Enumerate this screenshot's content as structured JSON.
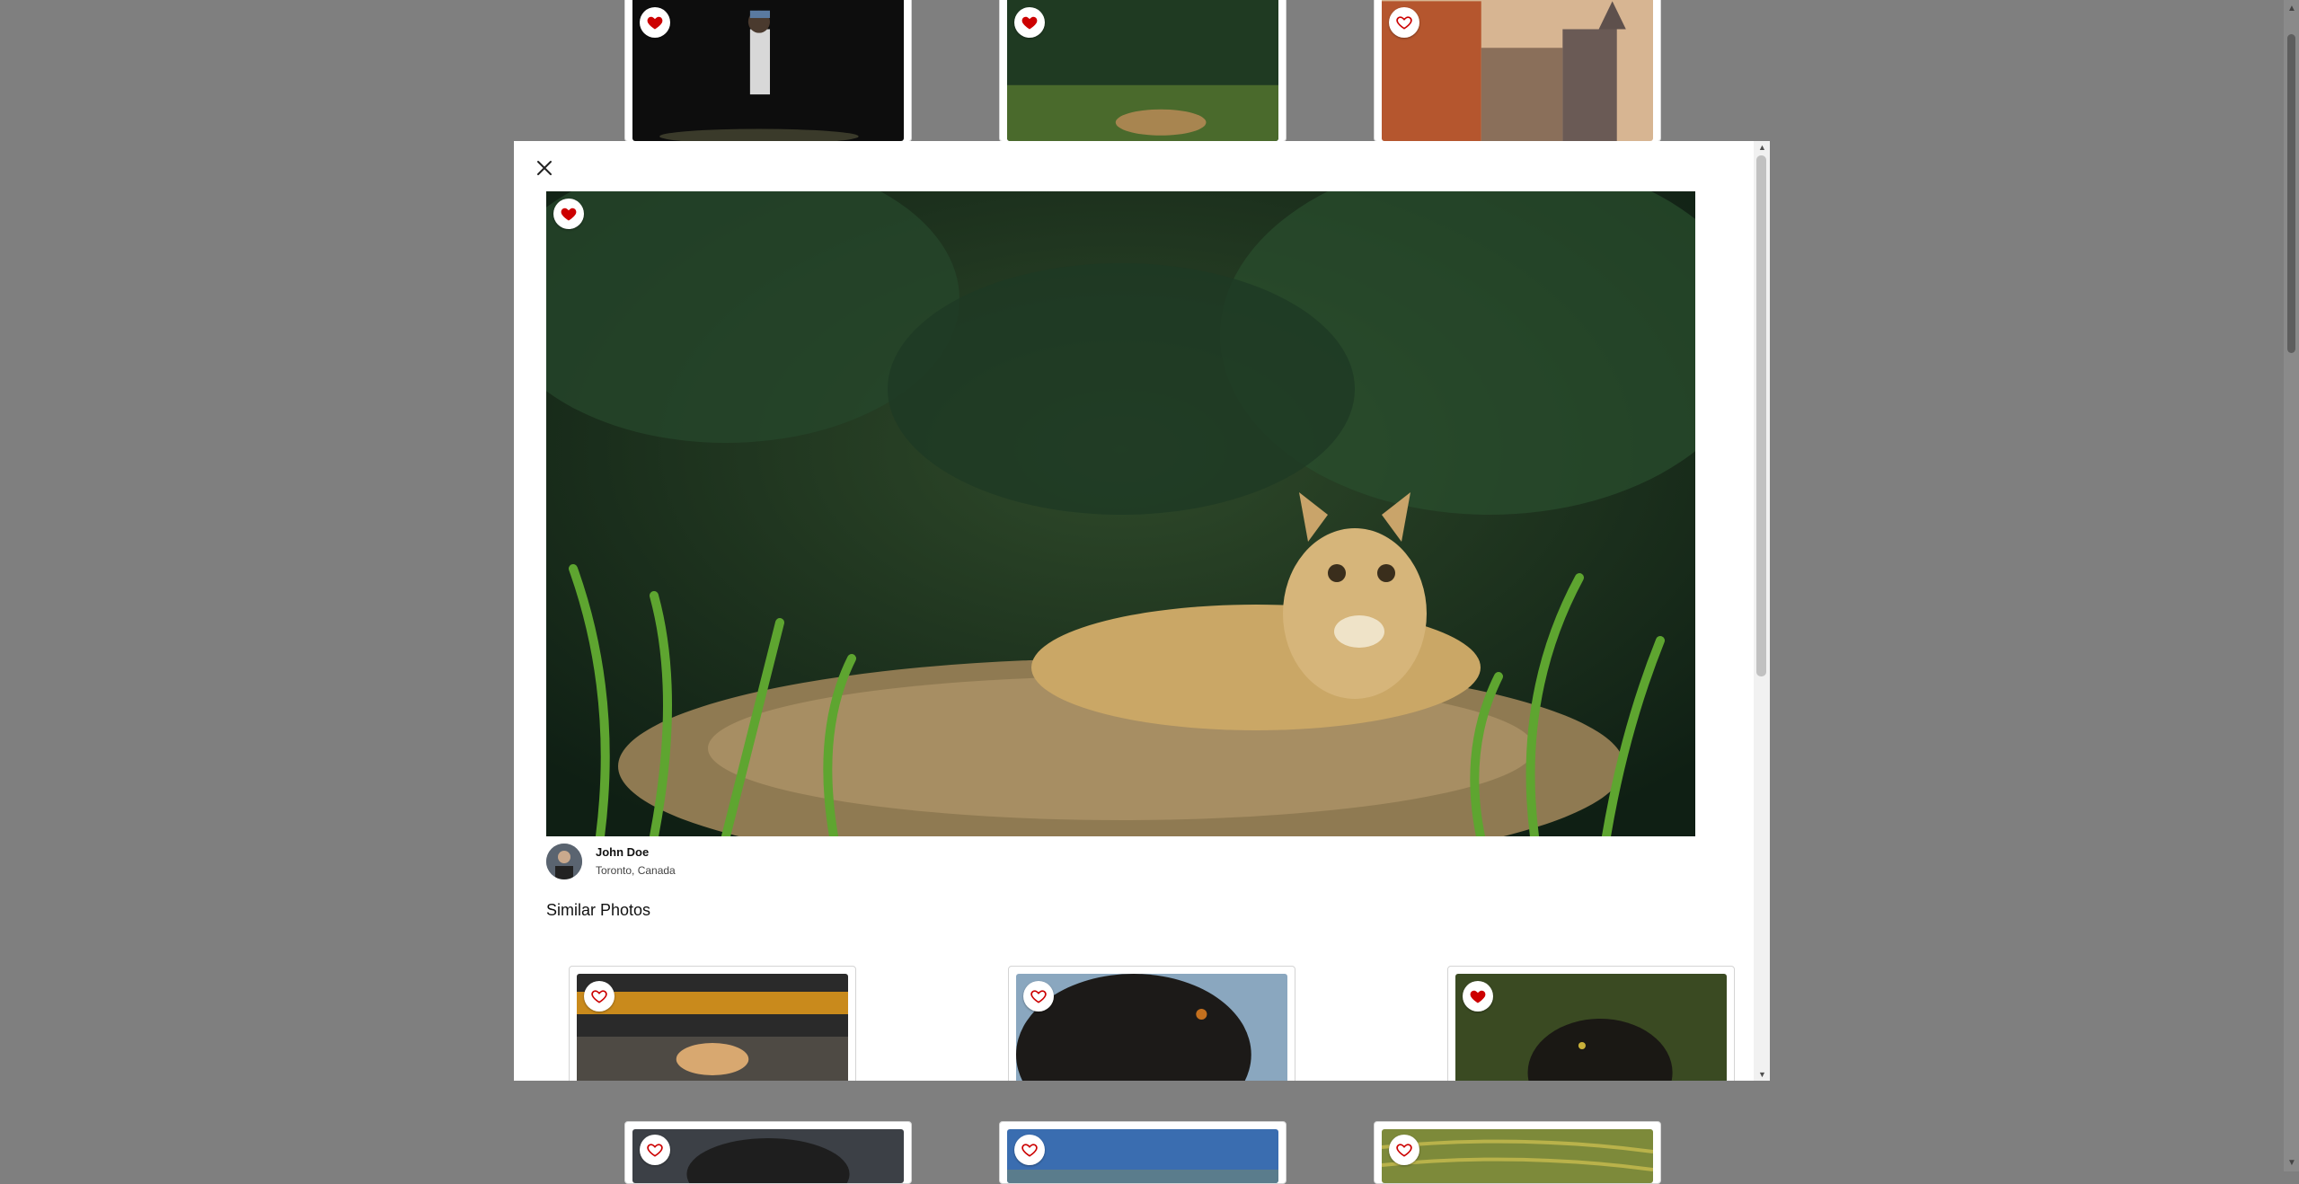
{
  "colors": {
    "accent_heart": "#cc0000",
    "backdrop": "#7f7f7f"
  },
  "background_grid": {
    "top_row": [
      {
        "icon": "heart-filled-icon",
        "favorited": true
      },
      {
        "icon": "heart-filled-icon",
        "favorited": true
      },
      {
        "icon": "heart-outline-icon",
        "favorited": false
      }
    ],
    "bottom_row": [
      {
        "icon": "heart-outline-icon",
        "favorited": false
      },
      {
        "icon": "heart-outline-icon",
        "favorited": false
      },
      {
        "icon": "heart-outline-icon",
        "favorited": false
      }
    ]
  },
  "modal": {
    "close_icon": "close-icon",
    "main_photo": {
      "favorited": true,
      "icon": "heart-filled-icon"
    },
    "author": {
      "name": "John Doe",
      "location": "Toronto, Canada"
    },
    "similar_title": "Similar Photos",
    "similar_photos": [
      {
        "favorited": false,
        "icon": "heart-outline-icon"
      },
      {
        "favorited": false,
        "icon": "heart-outline-icon"
      },
      {
        "favorited": true,
        "icon": "heart-filled-icon"
      }
    ]
  }
}
